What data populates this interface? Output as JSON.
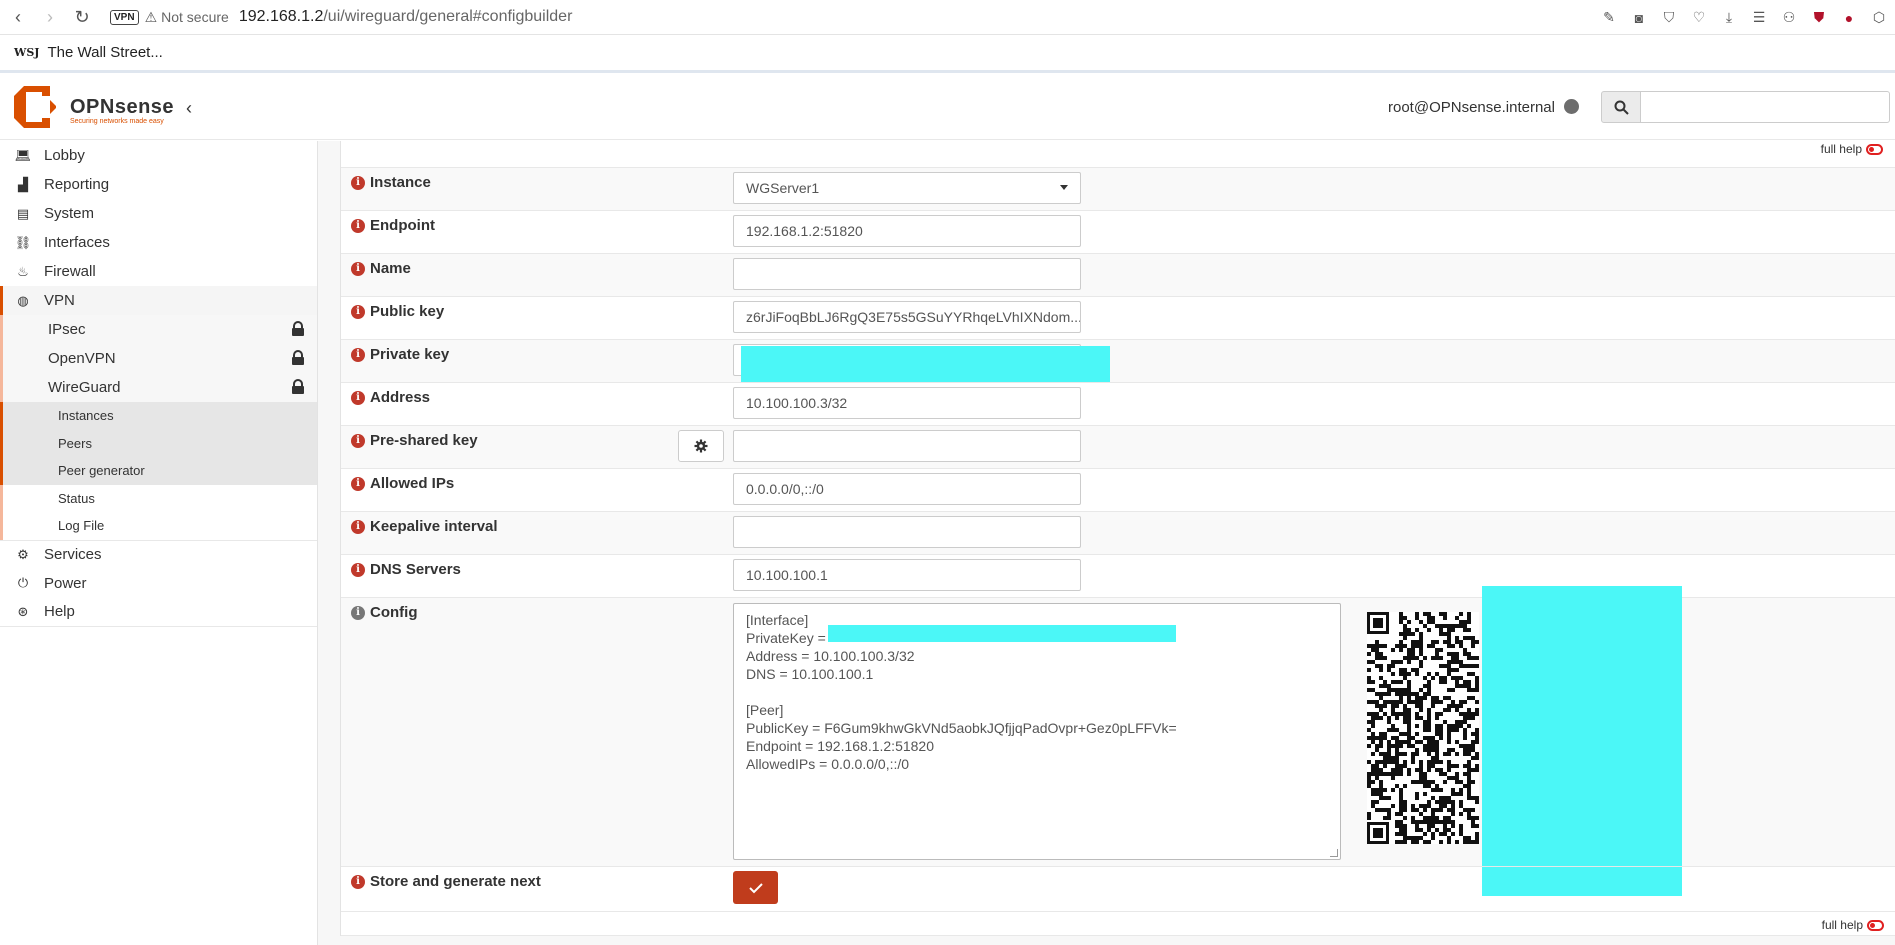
{
  "browser": {
    "vpn_badge": "VPN",
    "security_label": "Not secure",
    "url_host": "192.168.1.2",
    "url_path": "/ui/wireguard/general#configbuilder",
    "bookmark_icon": "WSJ",
    "bookmark_label": "The Wall Street..."
  },
  "header": {
    "brand": "OPNsense",
    "tagline": "Securing networks made easy",
    "user": "root@OPNsense.internal",
    "search_placeholder": ""
  },
  "sidebar": {
    "items": [
      {
        "label": "Lobby",
        "icon": "laptop-icon"
      },
      {
        "label": "Reporting",
        "icon": "chart-icon"
      },
      {
        "label": "System",
        "icon": "server-icon"
      },
      {
        "label": "Interfaces",
        "icon": "sitemap-icon"
      },
      {
        "label": "Firewall",
        "icon": "fire-icon"
      },
      {
        "label": "VPN",
        "icon": "globe-icon"
      }
    ],
    "vpn_sub": [
      "IPsec",
      "OpenVPN",
      "WireGuard"
    ],
    "wireguard_sub": [
      "Instances",
      "Peers",
      "Peer generator",
      "Status",
      "Log File"
    ],
    "bottom_items": [
      {
        "label": "Services",
        "icon": "gear-icon"
      },
      {
        "label": "Power",
        "icon": "plug-icon"
      },
      {
        "label": "Help",
        "icon": "lifebuoy-icon"
      }
    ]
  },
  "form": {
    "full_help": "full help",
    "instance_label": "Instance",
    "instance_value": "WGServer1",
    "endpoint_label": "Endpoint",
    "endpoint_value": "192.168.1.2:51820",
    "name_label": "Name",
    "name_value": "",
    "public_key_label": "Public key",
    "public_key_value": "z6rJiFoqBbLJ6RgQ3E75s5GSuYYRhqeLVhIXNdom...",
    "private_key_label": "Private key",
    "address_label": "Address",
    "address_value": "10.100.100.3/32",
    "psk_label": "Pre-shared key",
    "psk_value": "",
    "allowed_ips_label": "Allowed IPs",
    "allowed_ips_value": "0.0.0.0/0,::/0",
    "keepalive_label": "Keepalive interval",
    "keepalive_value": "",
    "dns_label": "DNS Servers",
    "dns_value": "10.100.100.1",
    "config_label": "Config",
    "config_lines": [
      "[Interface]",
      "PrivateKey = ",
      "Address = 10.100.100.3/32",
      "DNS = 10.100.100.1",
      "",
      "[Peer]",
      "PublicKey = F6Gum9khwGkVNd5aobkJQfjjqPadOvpr+Gez0pLFFVk=",
      "Endpoint = 192.168.1.2:51820",
      "AllowedIPs = 0.0.0.0/0,::/0"
    ],
    "store_label": "Store and generate next"
  },
  "colors": {
    "accent": "#d94f00",
    "submit": "#c03c1c",
    "info": "#c0392b",
    "redaction": "#4bf7f7"
  }
}
